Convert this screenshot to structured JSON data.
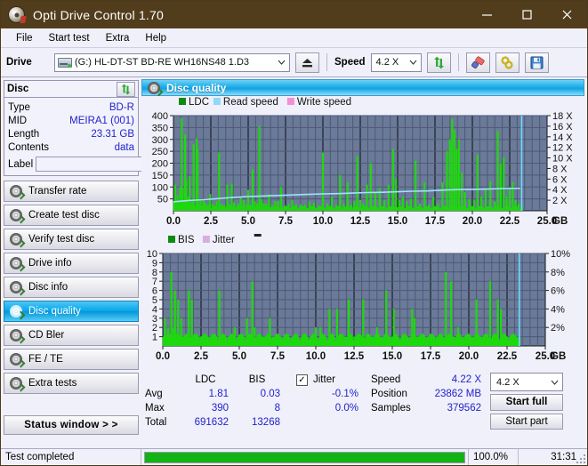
{
  "window": {
    "title": "Opti Drive Control 1.70",
    "icon": "disc-icon",
    "minimize": "minimize-icon",
    "maximize": "maximize-icon",
    "close": "close-icon"
  },
  "menu": {
    "items": [
      "File",
      "Start test",
      "Extra",
      "Help"
    ]
  },
  "toolbar": {
    "drive_label": "Drive",
    "drive_value": "(G:)  HL-DT-ST BD-RE  WH16NS48 1.D3",
    "eject_icon": "eject-icon",
    "speed_label": "Speed",
    "speed_value": "4.2 X",
    "refresh_icon": "refresh-icon",
    "erase_icon": "erase-icon",
    "link_icon": "link-icon",
    "save_icon": "save-icon"
  },
  "disc_panel": {
    "title": "Disc",
    "refresh_icon": "refresh-icon",
    "rows": [
      {
        "key": "Type",
        "value": "BD-R"
      },
      {
        "key": "MID",
        "value": "MEIRA1 (001)"
      },
      {
        "key": "Length",
        "value": "23.31 GB"
      },
      {
        "key": "Contents",
        "value": "data"
      }
    ],
    "label_key": "Label",
    "label_value": "",
    "label_placeholder": "",
    "label_button_icon": "disc-icon"
  },
  "sidebar": {
    "items": [
      {
        "label": "Transfer rate",
        "selected": false
      },
      {
        "label": "Create test disc",
        "selected": false
      },
      {
        "label": "Verify test disc",
        "selected": false
      },
      {
        "label": "Drive info",
        "selected": false
      },
      {
        "label": "Disc info",
        "selected": false
      },
      {
        "label": "Disc quality",
        "selected": true
      },
      {
        "label": "CD Bler",
        "selected": false
      },
      {
        "label": "FE / TE",
        "selected": false
      },
      {
        "label": "Extra tests",
        "selected": false
      }
    ],
    "status_window_button": "Status window > >"
  },
  "panel": {
    "title": "Disc quality",
    "icon": "disc-icon"
  },
  "stats": {
    "col_ldc": "LDC",
    "col_bis": "BIS",
    "rows": [
      {
        "key": "Avg",
        "ldc": "1.81",
        "bis": "0.03",
        "jitter": "-0.1%"
      },
      {
        "key": "Max",
        "ldc": "390",
        "bis": "8",
        "jitter": "0.0%"
      },
      {
        "key": "Total",
        "ldc": "691632",
        "bis": "13268",
        "jitter": ""
      }
    ],
    "jitter_label": "Jitter",
    "jitter_checked": true,
    "speed_key": "Speed",
    "speed_value": "4.22 X",
    "position_key": "Position",
    "position_value": "23862 MB",
    "samples_key": "Samples",
    "samples_value": "379562",
    "speed_select": "4.2 X",
    "start_full": "Start full",
    "start_part": "Start part"
  },
  "footer": {
    "status": "Test completed",
    "percent": "100.0%",
    "progress": 100,
    "time": "31:31"
  },
  "colors": {
    "title_bar": "#513d1c",
    "accent": "#0ea2e3",
    "value_text": "#2222cc",
    "plot_bg": "#6b7a99",
    "ldc_green": "#1fd80f",
    "read_speed": "#9fe2fb",
    "write_speed": "#f48fd6",
    "jitter_pink": "#d8aee0",
    "progress_green": "#12b312"
  },
  "chart_data": [
    {
      "type": "bar",
      "name": "ldc-chart",
      "title": "",
      "xlabel": "GB",
      "ylabel": "",
      "xlim": [
        0,
        25
      ],
      "xticks": [
        "0.0",
        "2.5",
        "5.0",
        "7.5",
        "10.0",
        "12.5",
        "15.0",
        "17.5",
        "20.0",
        "22.5",
        "25.0"
      ],
      "ylim": [
        0,
        400
      ],
      "yticks": [
        50,
        100,
        150,
        200,
        250,
        300,
        350,
        400
      ],
      "y2lim": [
        0,
        18
      ],
      "y2ticks": [
        "2 X",
        "4 X",
        "6 X",
        "8 X",
        "10 X",
        "12 X",
        "14 X",
        "16 X",
        "18 X"
      ],
      "grid": true,
      "legend": [
        {
          "label": "LDC",
          "color": "#0b8b12"
        },
        {
          "label": "Read speed",
          "color": "#8fd8f7"
        },
        {
          "label": "Write speed",
          "color": "#f48fd6"
        }
      ],
      "legend_position": "top-left",
      "series": [
        {
          "name": "LDC",
          "color": "#1fd80f",
          "x": [
            0.05,
            0.12,
            0.2,
            0.28,
            0.36,
            0.45,
            0.55,
            0.62,
            0.7,
            0.78,
            0.85,
            0.92,
            1.0,
            1.08,
            1.15,
            1.25,
            1.35,
            1.45,
            1.55,
            1.62,
            1.72,
            1.8,
            1.9,
            2.0,
            2.1,
            2.2,
            2.3,
            2.45,
            2.6,
            2.75,
            2.9,
            3.05,
            3.2,
            3.4,
            3.6,
            3.75,
            3.9,
            4.05,
            4.2,
            4.35,
            4.5,
            4.7,
            4.85,
            5.0,
            5.15,
            5.3,
            5.45,
            5.6,
            5.75,
            5.9,
            6.05,
            6.2,
            6.4,
            6.6,
            6.8,
            7.0,
            7.2,
            7.45,
            7.7,
            7.95,
            8.2,
            8.5,
            8.8,
            9.1,
            9.4,
            9.7,
            10.0,
            10.3,
            10.6,
            10.9,
            11.15,
            11.4,
            11.65,
            11.9,
            12.1,
            12.3,
            12.5,
            12.7,
            12.95,
            13.2,
            13.5,
            13.8,
            14.1,
            14.4,
            14.7,
            14.9,
            15.1,
            15.35,
            15.6,
            15.9,
            16.2,
            16.5,
            16.8,
            17.1,
            17.4,
            17.7,
            18.0,
            18.3,
            18.5,
            18.65,
            18.8,
            18.95,
            19.1,
            19.3,
            19.5,
            19.8,
            20.1,
            20.35,
            20.6,
            20.9,
            21.2,
            21.5,
            21.7,
            21.9,
            22.1,
            22.3,
            22.5,
            22.7,
            22.9,
            23.1,
            23.3
          ],
          "values": [
            40,
            110,
            30,
            65,
            25,
            100,
            390,
            95,
            35,
            320,
            130,
            30,
            60,
            145,
            25,
            40,
            280,
            20,
            305,
            260,
            30,
            50,
            20,
            45,
            35,
            20,
            28,
            70,
            30,
            22,
            40,
            245,
            30,
            25,
            110,
            25,
            115,
            35,
            20,
            30,
            60,
            45,
            25,
            88,
            25,
            175,
            40,
            30,
            355,
            48,
            32,
            30,
            70,
            25,
            40,
            42,
            100,
            22,
            30,
            45,
            28,
            26,
            25,
            40,
            35,
            22,
            245,
            30,
            60,
            25,
            150,
            30,
            120,
            25,
            40,
            230,
            45,
            30,
            110,
            200,
            80,
            95,
            45,
            110,
            260,
            135,
            45,
            60,
            40,
            50,
            210,
            30,
            120,
            28,
            60,
            30,
            120,
            250,
            300,
            385,
            340,
            260,
            300,
            160,
            80,
            50,
            45,
            235,
            60,
            90,
            125,
            40,
            335,
            200,
            225,
            60,
            95,
            120,
            45,
            30,
            25
          ]
        },
        {
          "name": "Read speed",
          "color": "#9fe2fb",
          "x": [
            0,
            1,
            2,
            3,
            4,
            5,
            6,
            7,
            8,
            9,
            10,
            11,
            12,
            13,
            14,
            15,
            16,
            17,
            18,
            19,
            20,
            21,
            22,
            23.2
          ],
          "values": [
            1.7,
            1.95,
            2.1,
            2.3,
            2.5,
            2.7,
            2.8,
            2.9,
            3.0,
            3.1,
            3.2,
            3.25,
            3.35,
            3.45,
            3.5,
            3.6,
            3.7,
            3.75,
            3.9,
            4.0,
            4.05,
            4.1,
            4.2,
            4.25
          ]
        }
      ]
    },
    {
      "type": "bar",
      "name": "bis-chart",
      "title": "",
      "xlabel": "GB",
      "ylabel": "",
      "xlim": [
        0,
        25
      ],
      "xticks": [
        "0.0",
        "2.5",
        "5.0",
        "7.5",
        "10.0",
        "12.5",
        "15.0",
        "17.5",
        "20.0",
        "22.5",
        "25.0"
      ],
      "ylim": [
        0,
        10
      ],
      "yticks": [
        1,
        2,
        3,
        4,
        5,
        6,
        7,
        8,
        9,
        10
      ],
      "y2lim": [
        0,
        10
      ],
      "y2ticks": [
        "2%",
        "4%",
        "6%",
        "8%",
        "10%"
      ],
      "grid": true,
      "legend": [
        {
          "label": "BIS",
          "color": "#0b8b12"
        },
        {
          "label": "Jitter",
          "color": "#d8aee0"
        }
      ],
      "legend_position": "top-left",
      "series": [
        {
          "name": "BIS",
          "color": "#1fd80f",
          "x": [
            0.05,
            0.15,
            0.25,
            0.35,
            0.45,
            0.55,
            0.62,
            0.7,
            0.8,
            0.9,
            1.0,
            1.1,
            1.2,
            1.3,
            1.4,
            1.5,
            1.6,
            1.7,
            1.8,
            1.9,
            2.0,
            2.1,
            2.2,
            2.35,
            2.5,
            2.65,
            2.8,
            2.95,
            3.1,
            3.3,
            3.5,
            3.7,
            3.9,
            4.1,
            4.3,
            4.5,
            4.7,
            4.9,
            5.1,
            5.3,
            5.5,
            5.7,
            5.85,
            6.0,
            6.2,
            6.4,
            6.6,
            6.8,
            7.0,
            7.2,
            7.45,
            7.7,
            7.95,
            8.2,
            8.5,
            8.8,
            9.1,
            9.4,
            9.7,
            10.0,
            10.3,
            10.6,
            10.9,
            11.15,
            11.4,
            11.65,
            11.9,
            12.15,
            12.4,
            12.55,
            12.8,
            13.1,
            13.4,
            13.7,
            14.0,
            14.3,
            14.6,
            14.85,
            15.1,
            15.4,
            15.7,
            16.0,
            16.3,
            16.45,
            16.7,
            17.0,
            17.3,
            17.6,
            17.9,
            18.2,
            18.5,
            18.7,
            18.85,
            19.0,
            19.3,
            19.6,
            19.9,
            20.2,
            20.5,
            20.8,
            21.1,
            21.4,
            21.7,
            21.9,
            22.1,
            22.3,
            22.5,
            22.7,
            22.9,
            23.1,
            23.3
          ],
          "values": [
            1,
            3,
            1,
            2,
            1,
            8,
            1,
            2,
            6,
            1,
            5,
            1,
            3,
            1,
            1,
            1,
            1,
            6,
            1,
            5,
            1,
            1,
            1,
            1,
            1,
            1,
            1,
            1,
            1,
            1,
            1,
            6,
            1,
            1,
            1,
            1,
            2,
            1,
            1,
            1,
            3,
            1,
            7,
            2,
            1,
            1,
            1,
            1,
            3,
            1,
            1,
            1,
            1,
            1,
            1,
            1,
            1,
            1,
            1,
            2,
            2,
            1,
            4,
            1,
            4,
            1,
            1,
            5,
            1,
            1,
            1,
            5,
            1,
            1,
            2,
            1,
            6,
            1,
            4,
            1,
            1,
            1,
            4,
            3,
            1,
            1,
            1,
            1,
            1,
            1,
            8,
            1,
            7,
            1,
            2,
            1,
            1,
            1,
            5,
            1,
            1,
            7,
            1,
            5,
            4,
            1,
            1,
            1,
            1,
            1,
            1
          ]
        }
      ]
    }
  ]
}
